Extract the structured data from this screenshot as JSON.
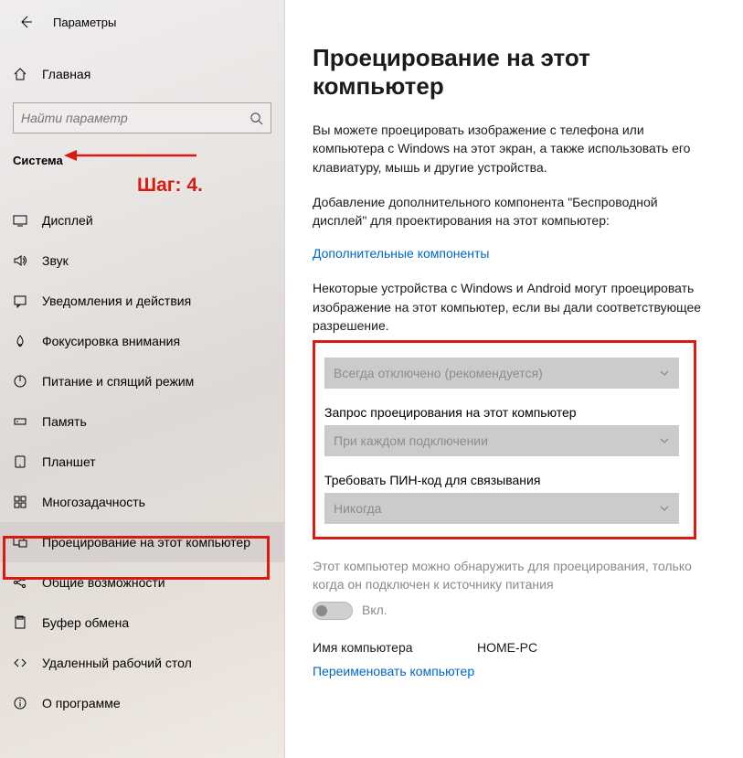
{
  "header": {
    "title": "Параметры"
  },
  "home_label": "Главная",
  "search": {
    "placeholder": "Найти параметр"
  },
  "category": "Система",
  "annotation": {
    "step": "Шаг: 4."
  },
  "nav": [
    {
      "id": "display",
      "label": "Дисплей"
    },
    {
      "id": "sound",
      "label": "Звук"
    },
    {
      "id": "notifications",
      "label": "Уведомления и действия"
    },
    {
      "id": "focus",
      "label": "Фокусировка внимания"
    },
    {
      "id": "power",
      "label": "Питание и спящий режим"
    },
    {
      "id": "storage",
      "label": "Память"
    },
    {
      "id": "tablet",
      "label": "Планшет"
    },
    {
      "id": "multitask",
      "label": "Многозадачность"
    },
    {
      "id": "projecting",
      "label": "Проецирование на этот компьютер"
    },
    {
      "id": "shared",
      "label": "Общие возможности"
    },
    {
      "id": "clipboard",
      "label": "Буфер обмена"
    },
    {
      "id": "remote",
      "label": "Удаленный рабочий стол"
    },
    {
      "id": "about",
      "label": "О программе"
    }
  ],
  "main": {
    "title": "Проецирование на этот компьютер",
    "intro": "Вы можете проецировать изображение с телефона или компьютера с Windows на этот экран, а также использовать его клавиатуру, мышь и другие устройства.",
    "addon_text": "Добавление дополнительного компонента \"Беспроводной дисплей\" для проектирования на этот компьютер:",
    "addon_link": "Дополнительные компоненты",
    "permission_intro": "Некоторые устройства с Windows и Android могут проецировать изображение на этот компьютер, если вы дали соответствующее разрешение.",
    "dropdown1_value": "Всегда отключено (рекомендуется)",
    "dropdown2_label": "Запрос проецирования на этот компьютер",
    "dropdown2_value": "При каждом подключении",
    "dropdown3_label": "Требовать ПИН-код для связывания",
    "dropdown3_value": "Никогда",
    "power_note": "Этот компьютер можно обнаружить для проецирования, только когда он подключен к источнику питания",
    "toggle_label": "Вкл.",
    "pc_name_label": "Имя компьютера",
    "pc_name_value": "HOME-PC",
    "rename_link": "Переименовать компьютер"
  }
}
